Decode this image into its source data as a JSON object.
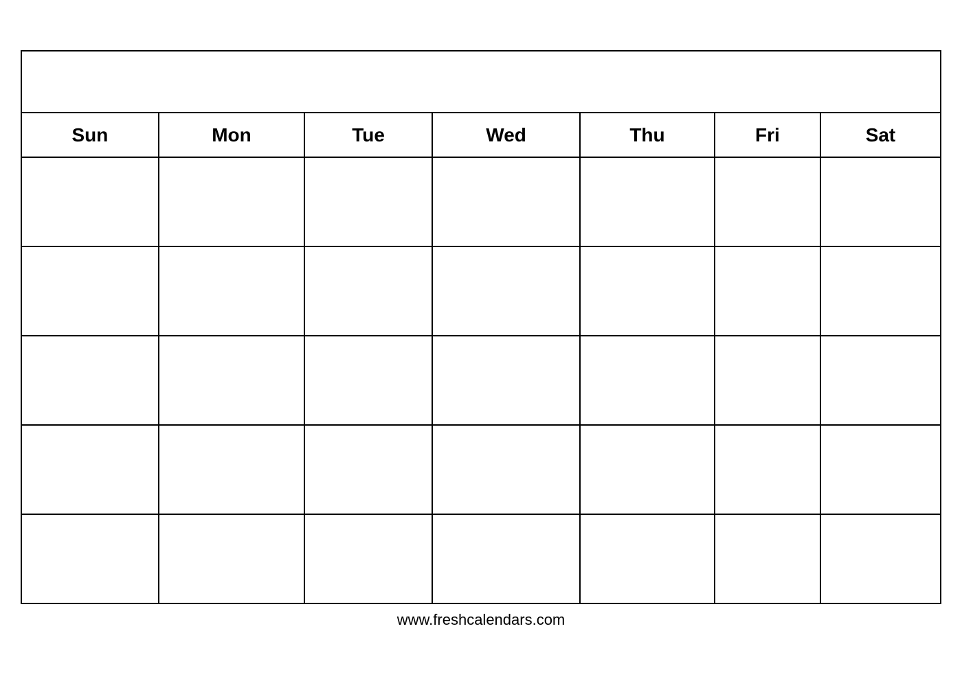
{
  "calendar": {
    "title": "",
    "days": [
      "Sun",
      "Mon",
      "Tue",
      "Wed",
      "Thu",
      "Fri",
      "Sat"
    ],
    "rows": 5,
    "footer": "www.freshcalendars.com"
  }
}
